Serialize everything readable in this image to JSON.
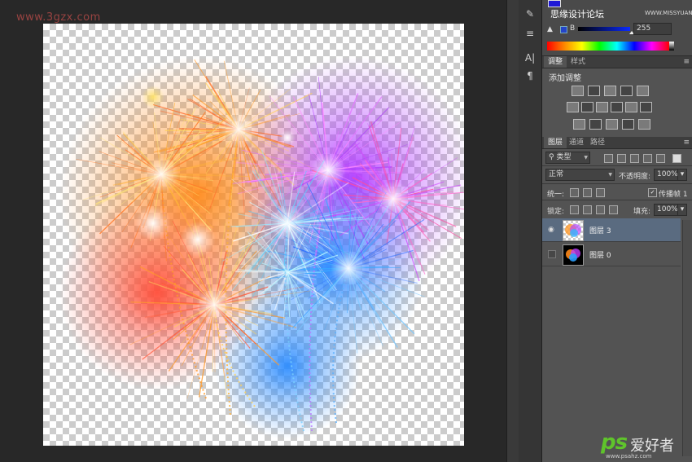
{
  "watermark_top": "www.3gzx.com",
  "top_caption": {
    "text": "思缘设计论坛",
    "site": "WWW.MISSYUAN.COM"
  },
  "color_panel": {
    "channel_label": "B",
    "value": "255",
    "fg_color": "#1e18d6"
  },
  "toolstrip": {
    "icons": [
      "brush-tool-icon",
      "adjust-sliders-icon",
      "character-icon",
      "paragraph-icon"
    ]
  },
  "adjustments": {
    "tabs": [
      {
        "label": "调整"
      },
      {
        "label": "样式"
      }
    ],
    "title": "添加调整"
  },
  "layers_panel": {
    "tabs": [
      {
        "label": "图层"
      },
      {
        "label": "通道"
      },
      {
        "label": "路径"
      }
    ],
    "filter_kind": "类型",
    "blend_mode": "正常",
    "opacity_label": "不透明度:",
    "opacity_value": "100%",
    "unify_label": "统一:",
    "propagate_label": "传播帧 1",
    "lock_label": "锁定:",
    "fill_label": "填充:",
    "fill_value": "100%",
    "layers": [
      {
        "name": "图层 3",
        "visible": true,
        "selected": true
      },
      {
        "name": "图层 0",
        "visible": false,
        "selected": false
      }
    ]
  },
  "watermark_bottom": {
    "brand": "ps",
    "cn": "爱好者",
    "url": "www.psahz.com"
  }
}
